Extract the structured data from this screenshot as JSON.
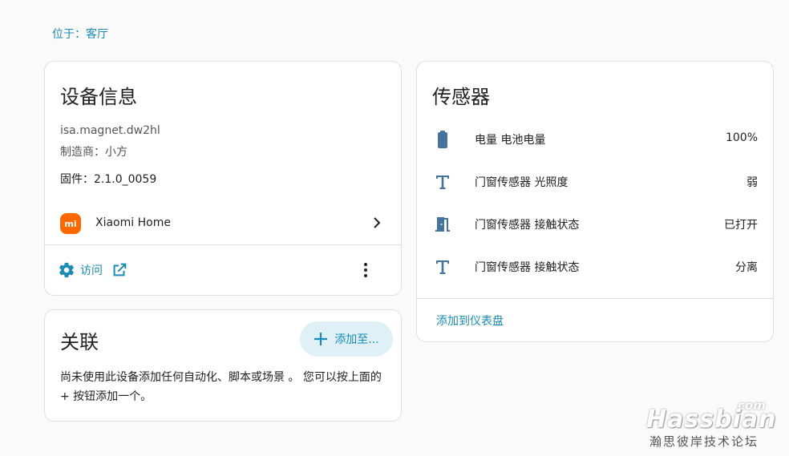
{
  "breadcrumb": "位于：客厅",
  "device_info": {
    "title": "设备信息",
    "model": "isa.magnet.dw2hl",
    "manufacturer": "制造商：小方",
    "firmware": "固件：2.1.0_0059",
    "integration": {
      "logo_text": "mi",
      "label": "Xiaomi Home"
    },
    "visit_label": "访问"
  },
  "related": {
    "title": "关联",
    "add_button": "添加至...",
    "text": "尚未使用此设备添加任何自动化、脚本或场景 。 您可以按上面的 + 按钮添加一个。"
  },
  "sensors": {
    "title": "传感器",
    "rows": [
      {
        "icon": "battery-icon",
        "name": "电量 电池电量",
        "value": "100%"
      },
      {
        "icon": "text-t-icon",
        "name": "门窗传感器 光照度",
        "value": "弱"
      },
      {
        "icon": "door-open-icon",
        "name": "门窗传感器 接触状态",
        "value": "已打开"
      },
      {
        "icon": "text-t-icon",
        "name": "门窗传感器 接触状态",
        "value": "分离"
      }
    ],
    "add_to_dashboard": "添加到仪表盘"
  },
  "watermark": {
    "brand": "Hassbian",
    "suffix": "com",
    "subtitle": "瀚思彼岸技术论坛"
  },
  "colors": {
    "accent": "#1a8bb3",
    "icon": "#44739e",
    "xiaomi": "#ff6700"
  }
}
